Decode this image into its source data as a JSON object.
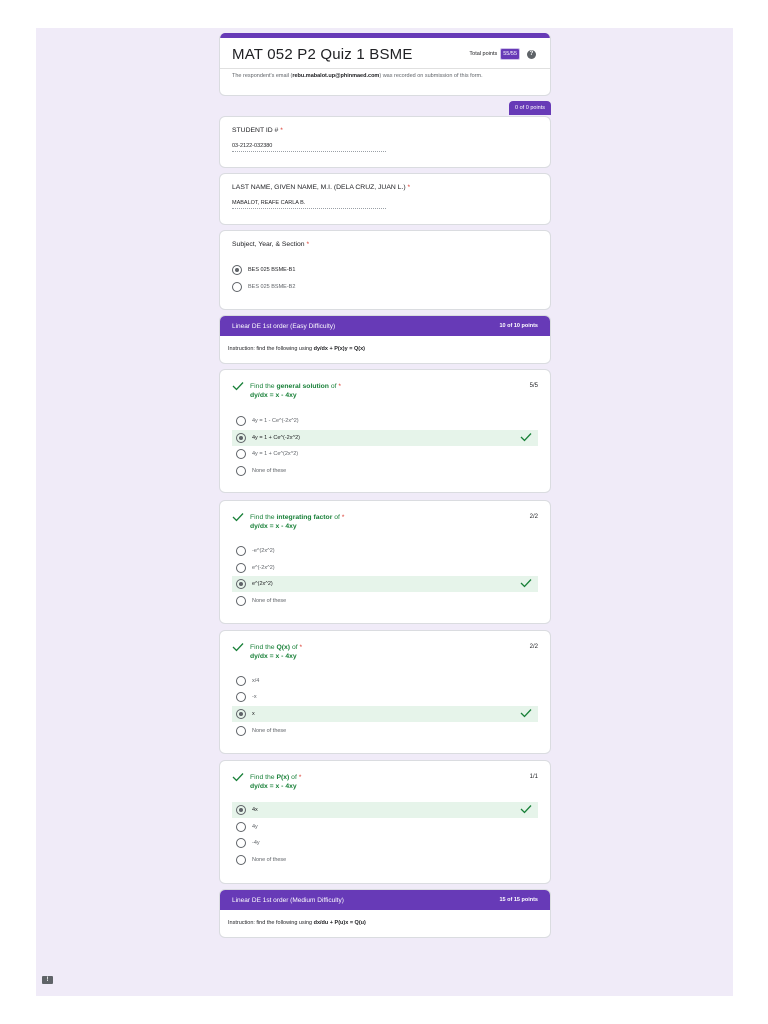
{
  "form": {
    "title": "MAT 052 P2 Quiz 1 BSME",
    "total_points_label": "Total points",
    "total_points_value": "55/55",
    "email_note_before": "The respondent's email (",
    "email": "rebu.mabalot.up@phinmaed.com",
    "email_note_after": ") was recorded on submission of this form.",
    "header_points": "0 of 0 points"
  },
  "student_id": {
    "label": "STUDENT ID #",
    "required": "*",
    "value": "03-2122-032380"
  },
  "full_name": {
    "label": "LAST NAME, GIVEN NAME, M.I. (DELA CRUZ, JUAN L.)",
    "required": "*",
    "value": "MABALOT, REAFE CARLA B."
  },
  "section_question": {
    "label": "Subject, Year, & Section",
    "required": "*",
    "options": [
      "BES 025 BSME-B1",
      "BES 025 BSME-B2"
    ]
  },
  "section1": {
    "title": "Linear DE 1st order (Easy Difficulty)",
    "points": "10 of 10 points",
    "instruction_prefix": "Instruction: find the following using ",
    "instruction_eq": "dy/dx + P(x)y = Q(x)"
  },
  "questions": [
    {
      "prefix": "Find the ",
      "keyword": "general solution",
      "suffix": " of ",
      "required": "*",
      "equation": "dy/dx = x - 4xy",
      "score": "5/5",
      "options": [
        "4y = 1 - Ce^(-2x^2)",
        "4y = 1 + Ce^(-2x^2)",
        "4y = 1 + Ce^(2x^2)",
        "None of these"
      ]
    },
    {
      "prefix": "Find the ",
      "keyword": "integrating factor",
      "suffix": " of ",
      "required": "*",
      "equation": "dy/dx = x - 4xy",
      "score": "2/2",
      "options": [
        "-e^(2x^2)",
        "e^(-2x^2)",
        "e^(2x^2)",
        "None of these"
      ]
    },
    {
      "prefix": "Find the ",
      "keyword": "Q(x)",
      "suffix": " of ",
      "required": "*",
      "equation": "dy/dx = x - 4xy",
      "score": "2/2",
      "options": [
        "x/4",
        "-x",
        "x",
        "None of these"
      ]
    },
    {
      "prefix": "Find the ",
      "keyword": "P(x)",
      "suffix": " of ",
      "required": "*",
      "equation": "dy/dx = x - 4xy",
      "score": "1/1",
      "options": [
        "4x",
        "4y",
        "-4y",
        "None of these"
      ]
    }
  ],
  "section2": {
    "title": "Linear DE 1st order (Medium Difficulty)",
    "points": "15 of 15 points",
    "instruction_prefix": "Instruction: find the following using ",
    "instruction_eq": "dx/du + P(u)x = Q(u)"
  },
  "icons": {
    "help": "help-circle-icon",
    "check": "check-icon",
    "feedback": "feedback-icon"
  },
  "colors": {
    "accent": "#673ab7",
    "correct_bg": "#e6f4ea",
    "correct_text": "#188038",
    "required": "#d93025"
  }
}
